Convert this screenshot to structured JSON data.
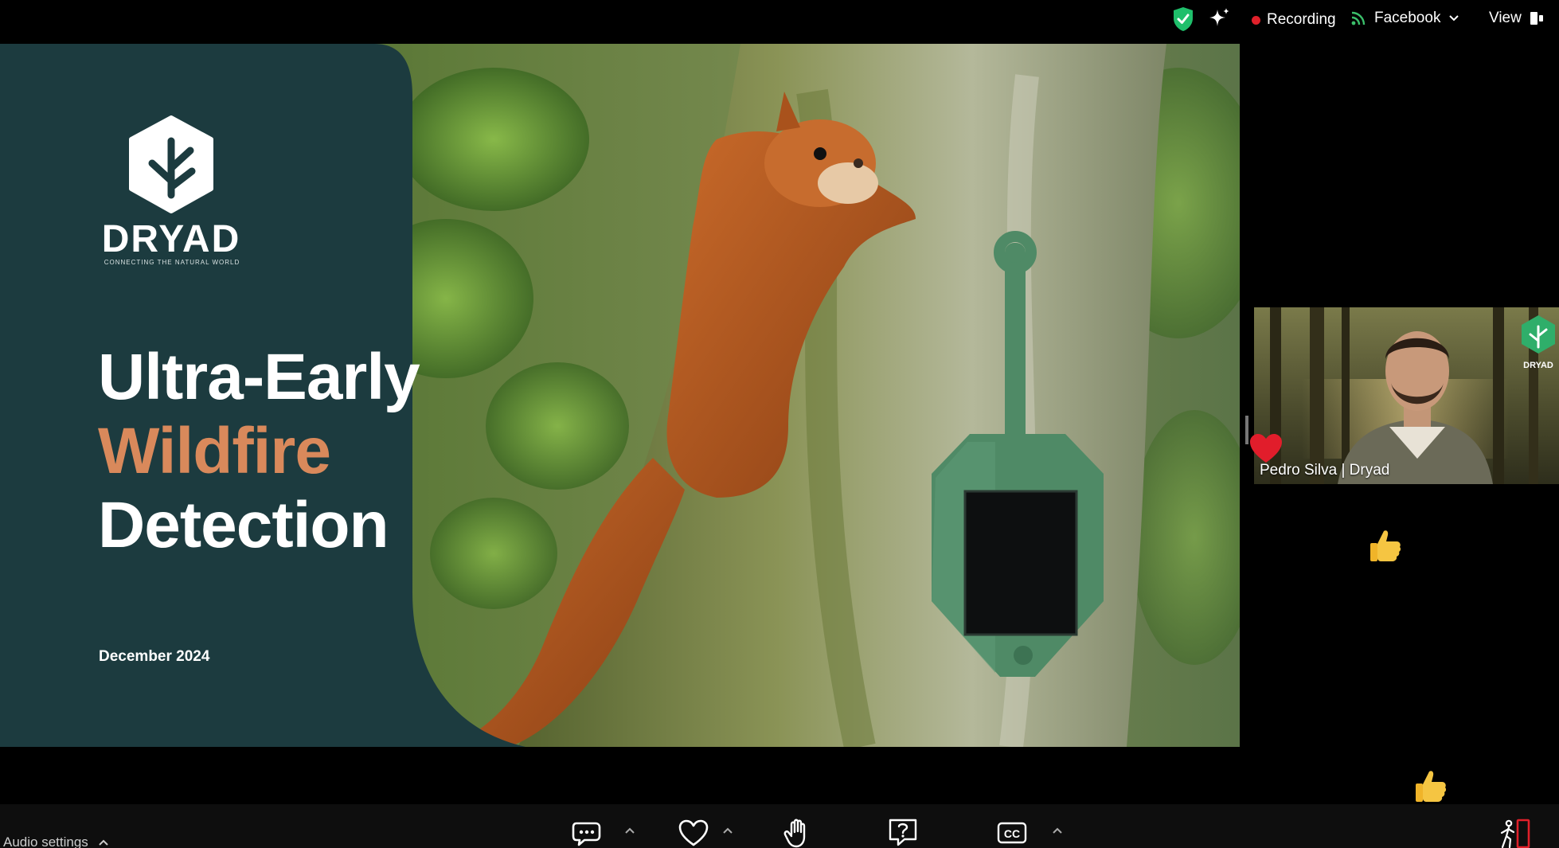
{
  "topbar": {
    "recording_label": "Recording",
    "stream_label": "Facebook",
    "view_label": "View"
  },
  "slide": {
    "brand": "DRYAD",
    "tagline": "CONNECTING THE NATURAL WORLD",
    "title_line1": "Ultra-Early",
    "title_line2": "Wildfire",
    "title_line3": "Detection",
    "date": "December 2024"
  },
  "speaker": {
    "name": "Pedro Silva | Dryad",
    "badge": "DRYAD"
  },
  "toolbar": {
    "audio_settings": "Audio settings",
    "captions_label": "CC"
  },
  "colors": {
    "slide_panel": "#1c3b3f",
    "title_accent": "#d9895b",
    "device_green": "#4f8a66",
    "recording_red": "#e0202a",
    "shield_green": "#1fbf6b"
  },
  "icons": {
    "shield": "shield-check-icon",
    "spark": "sparkle-icon",
    "stream": "broadcast-icon",
    "chat": "chat-icon",
    "reactions": "heart-icon",
    "raise_hand": "hand-icon",
    "qa": "question-icon",
    "captions": "captions-icon",
    "exit": "leave-icon"
  }
}
